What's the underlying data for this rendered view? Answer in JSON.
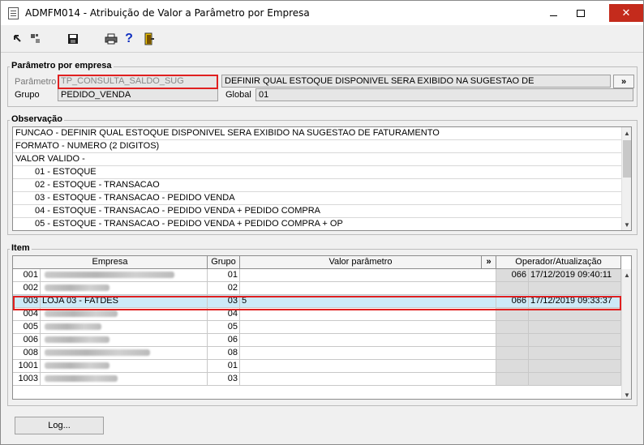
{
  "window": {
    "title": "ADMFM014 - Atribuição de Valor a Parâmetro por Empresa",
    "close_glyph": "✕"
  },
  "toolbar": {
    "icons": [
      "previous-icon",
      "next-icon",
      "save-icon",
      "print-icon",
      "help-icon",
      "exit-icon"
    ],
    "help_glyph": "?"
  },
  "param": {
    "legend": "Parâmetro por empresa",
    "parametro_label": "Parâmetro",
    "parametro_value": "TP_CONSULTA_SALDO_SUG",
    "descricao_value": "DEFINIR QUAL ESTOQUE DISPONIVEL SERA EXIBIDO NA SUGESTAO DE",
    "more_label": "»",
    "grupo_label": "Grupo",
    "grupo_value": "PEDIDO_VENDA",
    "global_label": "Global",
    "global_value": "01"
  },
  "observacao": {
    "legend": "Observação",
    "lines": [
      "FUNCAO - DEFINIR QUAL ESTOQUE DISPONIVEL SERA EXIBIDO NA SUGESTAO DE FATURAMENTO",
      "FORMATO - NUMERO (2 DIGITOS)",
      "VALOR VALIDO -",
      "01 - ESTOQUE",
      "02 - ESTOQUE - TRANSACAO",
      "03 - ESTOQUE - TRANSACAO - PEDIDO VENDA",
      "04 - ESTOQUE - TRANSACAO - PEDIDO VENDA + PEDIDO COMPRA",
      "05 - ESTOQUE - TRANSACAO - PEDIDO VENDA + PEDIDO COMPRA + OP"
    ]
  },
  "item": {
    "legend": "Item",
    "columns": {
      "empresa": "Empresa",
      "grupo": "Grupo",
      "valor": "Valor parâmetro",
      "more": "»",
      "operador": "Operador/Atualização"
    },
    "rows": [
      {
        "code": "001",
        "name": "",
        "grupo": "01",
        "valor": "",
        "operador": "066",
        "data": "17/12/2019 09:40:11"
      },
      {
        "code": "002",
        "name": "",
        "grupo": "02",
        "valor": "",
        "operador": "",
        "data": ""
      },
      {
        "code": "003",
        "name": "LOJA 03 - FATDES",
        "grupo": "03",
        "valor": "5",
        "operador": "066",
        "data": "17/12/2019 09:33:37"
      },
      {
        "code": "004",
        "name": "",
        "grupo": "04",
        "valor": "",
        "operador": "",
        "data": ""
      },
      {
        "code": "005",
        "name": "",
        "grupo": "05",
        "valor": "",
        "operador": "",
        "data": ""
      },
      {
        "code": "006",
        "name": "",
        "grupo": "06",
        "valor": "",
        "operador": "",
        "data": ""
      },
      {
        "code": "008",
        "name": "",
        "grupo": "08",
        "valor": "",
        "operador": "",
        "data": ""
      },
      {
        "code": "1001",
        "name": "",
        "grupo": "01",
        "valor": "",
        "operador": "",
        "data": ""
      },
      {
        "code": "1003",
        "name": "",
        "grupo": "03",
        "valor": "",
        "operador": "",
        "data": ""
      }
    ]
  },
  "footer": {
    "log_label": "Log..."
  }
}
